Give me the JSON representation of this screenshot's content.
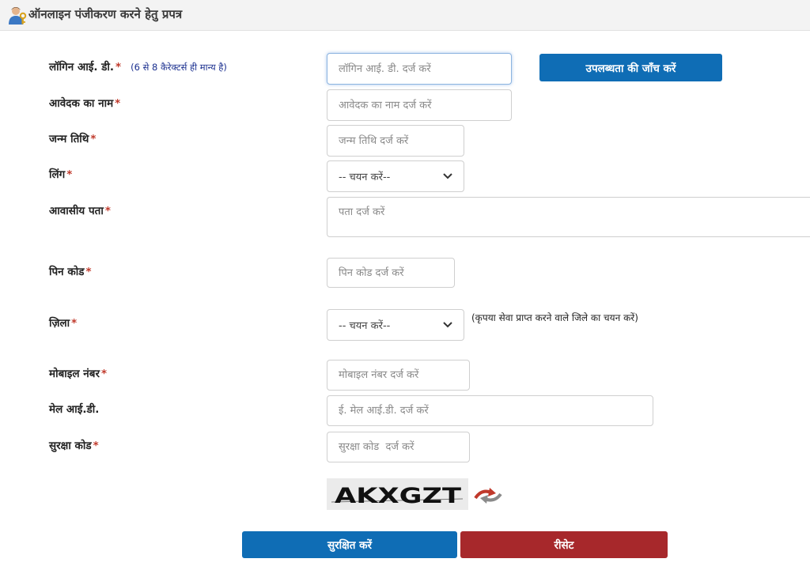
{
  "header": {
    "title": "ऑनलाइन पंजीकरण करने हेतु प्रपत्र",
    "icon": "user-key-icon"
  },
  "form": {
    "login_id": {
      "label": "लॉगिन आई. डी.",
      "required": "*",
      "hint": "(6 से 8 कैरेक्टर्स ही मान्य है)",
      "placeholder": "लॉगिन आई. डी. दर्ज करें",
      "check_button": "उपलब्धता की जाँच करें"
    },
    "applicant_name": {
      "label": "आवेदक का नाम",
      "required": "*",
      "placeholder": "आवेदक का नाम दर्ज करें"
    },
    "dob": {
      "label": "जन्म तिथि",
      "required": "*",
      "placeholder": "जन्म तिथि दर्ज करें"
    },
    "gender": {
      "label": "लिंग",
      "required": "*",
      "selected": "-- चयन करें--"
    },
    "address": {
      "label": "आवासीय पता",
      "required": "*",
      "placeholder": "पता दर्ज करें"
    },
    "pincode": {
      "label": "पिन कोड",
      "required": "*",
      "placeholder": "पिन कोड दर्ज करें"
    },
    "district": {
      "label": "ज़िला",
      "required": "*",
      "selected": "-- चयन करें--",
      "note": "(कृपया सेवा प्राप्त करने वाले जिले का चयन करें)"
    },
    "mobile": {
      "label": "मोबाइल नंबर",
      "required": "*",
      "placeholder": "मोबाइल नंबर दर्ज करें"
    },
    "email": {
      "label": "मेल आई.डी.",
      "placeholder": "ई. मेल आई.डी. दर्ज करें"
    },
    "security_code": {
      "label": "सुरक्षा कोड",
      "required": "*",
      "placeholder": "सुरक्षा कोड  दर्ज करें"
    },
    "captcha_text": "AKXGZT",
    "refresh_icon": "refresh-arrows-icon"
  },
  "actions": {
    "save": "सुरक्षित करें",
    "reset": "रीसेट"
  },
  "colors": {
    "primary_button": "#0f6db5",
    "reset_button": "#a7282b",
    "required_mark": "#c0392b",
    "hint_text": "#1a2f8f"
  }
}
